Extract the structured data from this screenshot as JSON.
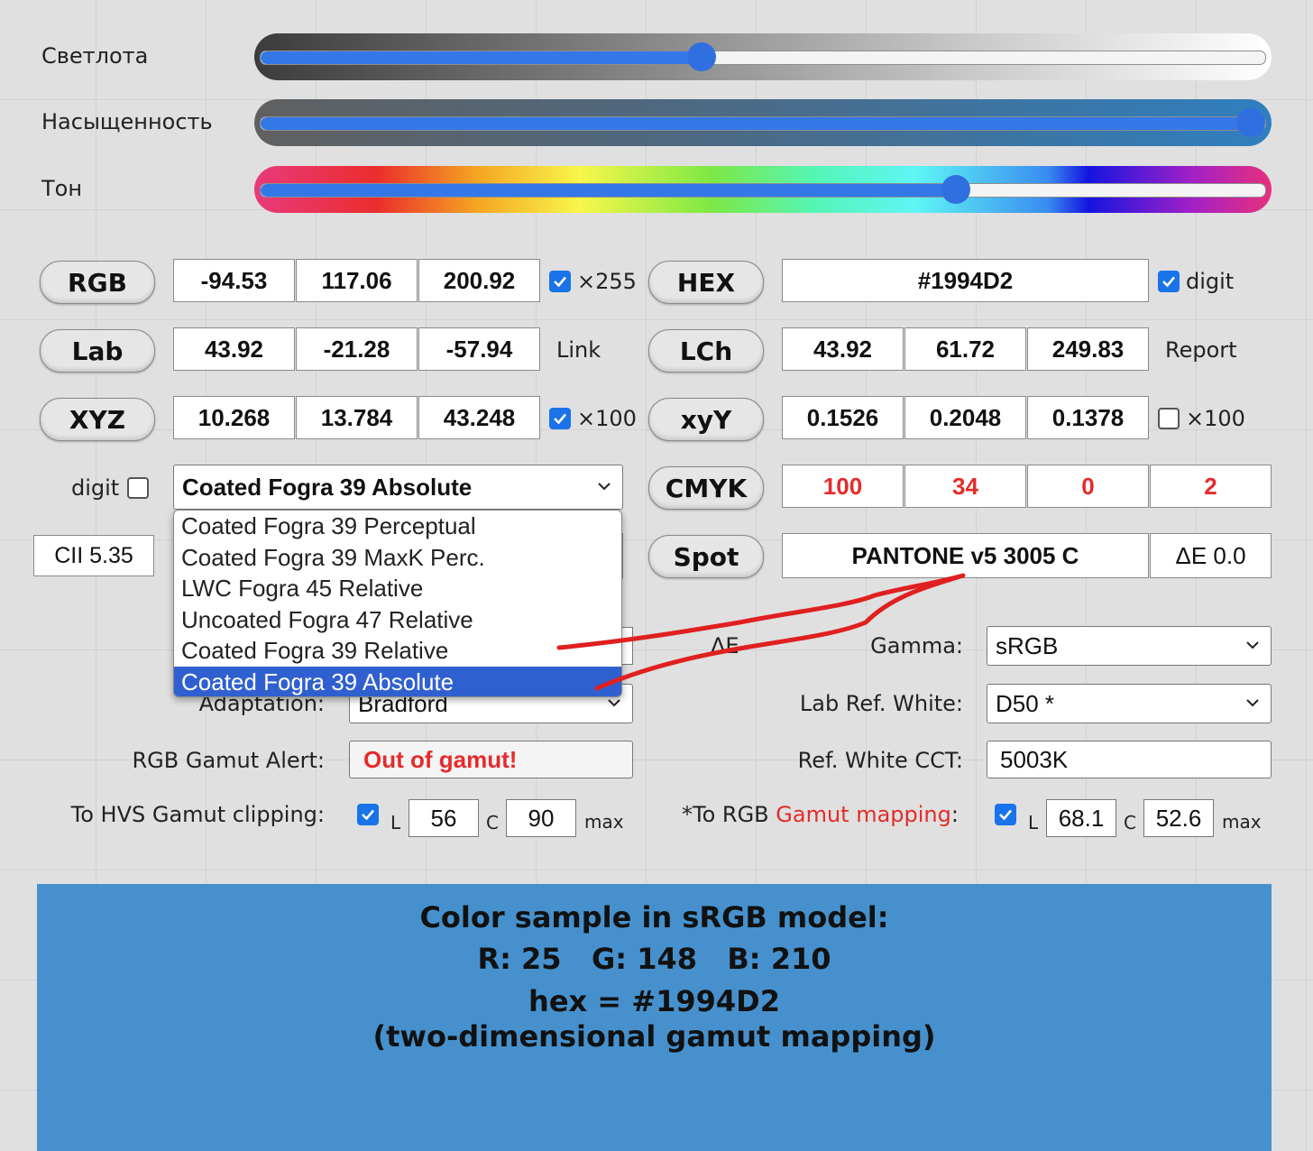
{
  "sliders": {
    "lightness": {
      "label": "Светлота",
      "value": 0.44
    },
    "saturation": {
      "label": "Насыщенность",
      "value": 0.98
    },
    "hue": {
      "label": "Тон",
      "value": 0.69
    }
  },
  "rgb": {
    "button": "RGB",
    "values": [
      "-94.53",
      "117.06",
      "200.92"
    ],
    "check_label": "×255",
    "checked": true
  },
  "hex": {
    "button": "HEX",
    "value": "#1994D2",
    "check_label": "digit",
    "checked": true
  },
  "lab": {
    "button": "Lab",
    "values": [
      "43.92",
      "-21.28",
      "-57.94"
    ],
    "link_label": "Link"
  },
  "lch": {
    "button": "LCh",
    "values": [
      "43.92",
      "61.72",
      "249.83"
    ],
    "report_label": "Report"
  },
  "xyz": {
    "button": "XYZ",
    "values": [
      "10.268",
      "13.784",
      "43.248"
    ],
    "check_label": "×100",
    "checked": true
  },
  "xyy": {
    "button": "xyY",
    "values": [
      "0.1526",
      "0.2048",
      "0.1378"
    ],
    "check_label": "×100",
    "checked": false
  },
  "digit_label": "digit",
  "profile_select": {
    "value": "Coated Fogra 39 Absolute",
    "options": [
      "Coated Fogra 39 Perceptual",
      "Coated Fogra 39 MaxK Perc.",
      "LWC Fogra 45 Relative",
      "Uncoated Fogra 47 Relative",
      "Coated Fogra 39 Relative",
      "Coated Fogra 39 Absolute"
    ],
    "selected_index": 5
  },
  "cmyk": {
    "button": "CMYK",
    "values": [
      "100",
      "34",
      "0",
      "2"
    ]
  },
  "cii": "CII 5.35",
  "spot": {
    "button": "Spot",
    "value": "PANTONE v5 3005 C",
    "delta": "ΔE 0.0"
  },
  "partial_de": "ΔE",
  "gamma": {
    "label": "Gamma:",
    "value": "sRGB"
  },
  "adaptation": {
    "label": "Adaptation:",
    "value": "Bradford"
  },
  "lab_ref_white": {
    "label": "Lab Ref. White:",
    "value": "D50 *"
  },
  "gamut_alert": {
    "label": "RGB Gamut Alert:",
    "value": "Out of gamut!"
  },
  "ref_white_cct": {
    "label": "Ref. White CCT:",
    "value": "5003K"
  },
  "hvs_clipping": {
    "label": "To HVS Gamut clipping:",
    "checked": true,
    "l_label": "L",
    "l_value": "56",
    "c_label": "C",
    "c_value": "90",
    "max_label": "max"
  },
  "rgb_mapping": {
    "label_prefix": "*To RGB ",
    "label_highlight": "Gamut mapping",
    "label_suffix": ":",
    "checked": true,
    "l_label": "L",
    "l_value": "68.1",
    "c_label": "C",
    "c_value": "52.6",
    "max_label": "max"
  },
  "sample": {
    "color": "#4691cd",
    "line1": "Color sample in sRGB model:",
    "line2": "R: 25   G: 148   B: 210",
    "line3": "hex = #1994D2",
    "line4": "(two-dimensional gamut mapping)"
  },
  "colors": {
    "accent": "#1a73e8",
    "alert": "#e42b2b",
    "annotation": "#e02020",
    "selected_option": "#3060d0"
  }
}
